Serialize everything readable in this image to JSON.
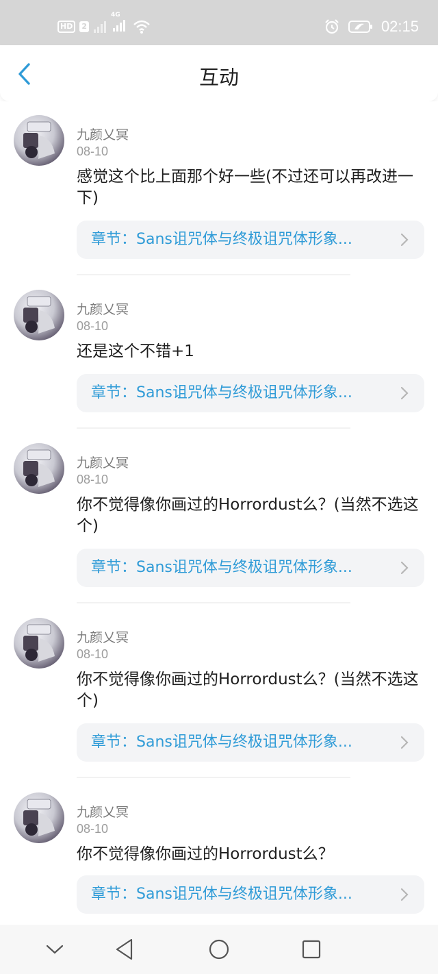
{
  "status_bar": {
    "hd_label": "HD",
    "sim_label": "2",
    "network_label": "4G",
    "time": "02:15",
    "icons": [
      "hd-icon",
      "sim-icon",
      "signal-icon",
      "signal-4g-icon",
      "wifi-icon",
      "alarm-icon",
      "battery-icon"
    ]
  },
  "header": {
    "title": "互动",
    "back_icon": "chevron-left-icon"
  },
  "comments": [
    {
      "username": "九颜乂冥",
      "date": "08-10",
      "text": "感觉这个比上面那个好一些(不过还可以再改进一下)",
      "chapter": "章节：Sans诅咒体与终极诅咒体形象..."
    },
    {
      "username": "九颜乂冥",
      "date": "08-10",
      "text": "还是这个不错+1",
      "chapter": "章节：Sans诅咒体与终极诅咒体形象..."
    },
    {
      "username": "九颜乂冥",
      "date": "08-10",
      "text": "你不觉得像你画过的Horrordust么？(当然不选这个)",
      "chapter": "章节：Sans诅咒体与终极诅咒体形象..."
    },
    {
      "username": "九颜乂冥",
      "date": "08-10",
      "text": "你不觉得像你画过的Horrordust么？(当然不选这个)",
      "chapter": "章节：Sans诅咒体与终极诅咒体形象..."
    },
    {
      "username": "九颜乂冥",
      "date": "08-10",
      "text": "你不觉得像你画过的Horrordust么？",
      "chapter": "章节：Sans诅咒体与终极诅咒体形象..."
    }
  ],
  "nav_bar": {
    "icons": [
      "chevron-down-icon",
      "back-triangle-icon",
      "home-circle-icon",
      "recents-square-icon"
    ]
  },
  "colors": {
    "status_bar_bg": "#d6d6d6",
    "accent_blue": "#2f9bd7",
    "link_bg": "#f3f4f6"
  }
}
